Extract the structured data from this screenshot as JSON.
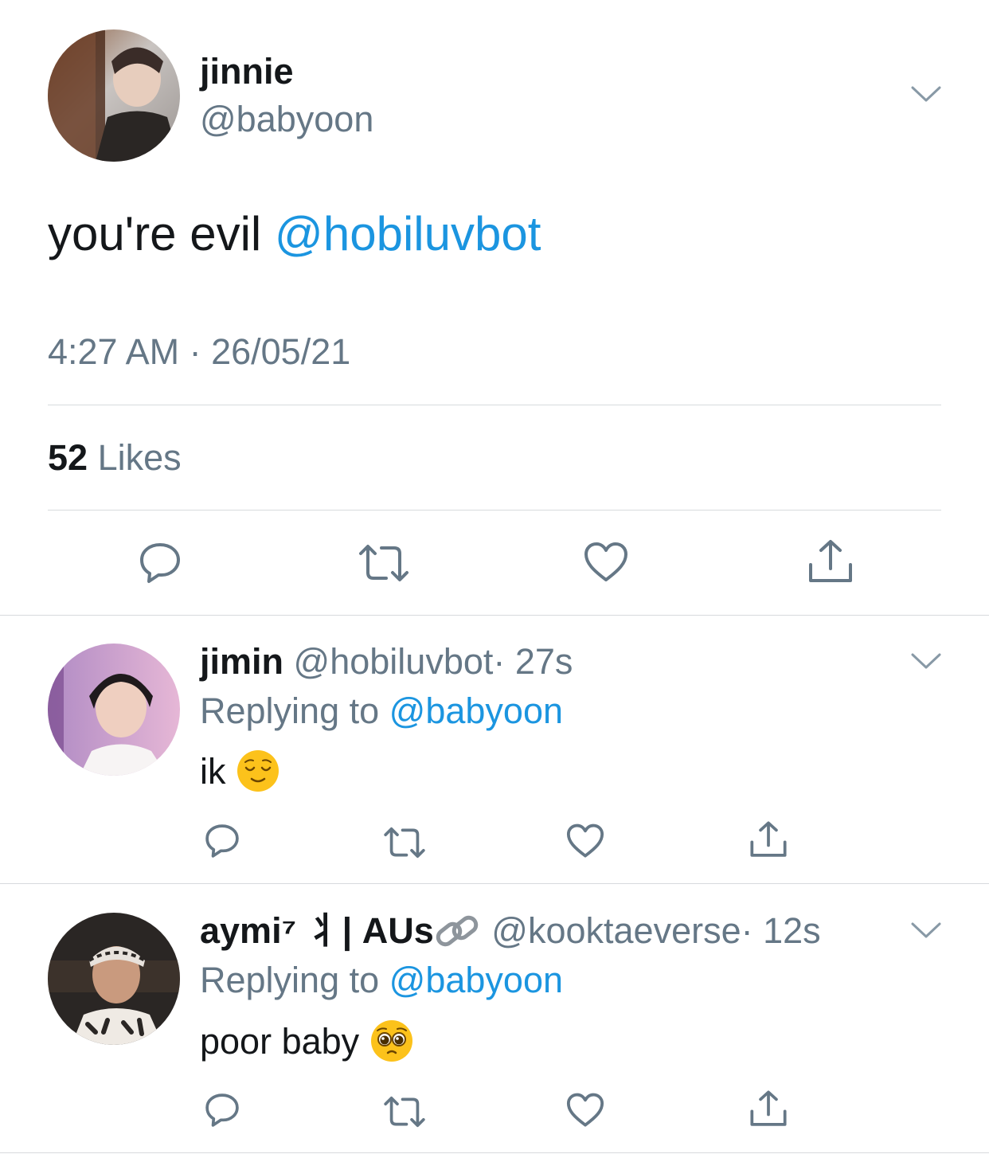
{
  "main_tweet": {
    "display_name": "jinnie",
    "handle": "@babyoon",
    "text": "you're evil",
    "mention": "@hobiluvbot",
    "timestamp": "4:27 AM · 26/05/21",
    "likes_count": "52",
    "likes_label": "Likes"
  },
  "replies": [
    {
      "display_name": "jimin",
      "handle": "@hobiluvbot",
      "time": "· 27s",
      "replying_label": "Replying to",
      "replying_to": "@babyoon",
      "text": "ik",
      "emoji": "relieved-face-icon"
    },
    {
      "display_name": "aymi⁷ ⺦| AUs",
      "handle": "@kooktaeverse",
      "time": "· 12s",
      "replying_label": "Replying to",
      "replying_to": "@babyoon",
      "text": "poor baby",
      "emoji": "pleading-face-icon"
    }
  ],
  "icons": {
    "reply": "reply-icon",
    "retweet": "retweet-icon",
    "like": "heart-icon",
    "share": "share-icon",
    "more": "chevron-down-icon",
    "link": "link-icon"
  },
  "colors": {
    "accent": "#1b95e0",
    "secondary_text": "#657786",
    "primary_text": "#14171a",
    "divider": "#d7dadd",
    "icon": "#657786"
  }
}
